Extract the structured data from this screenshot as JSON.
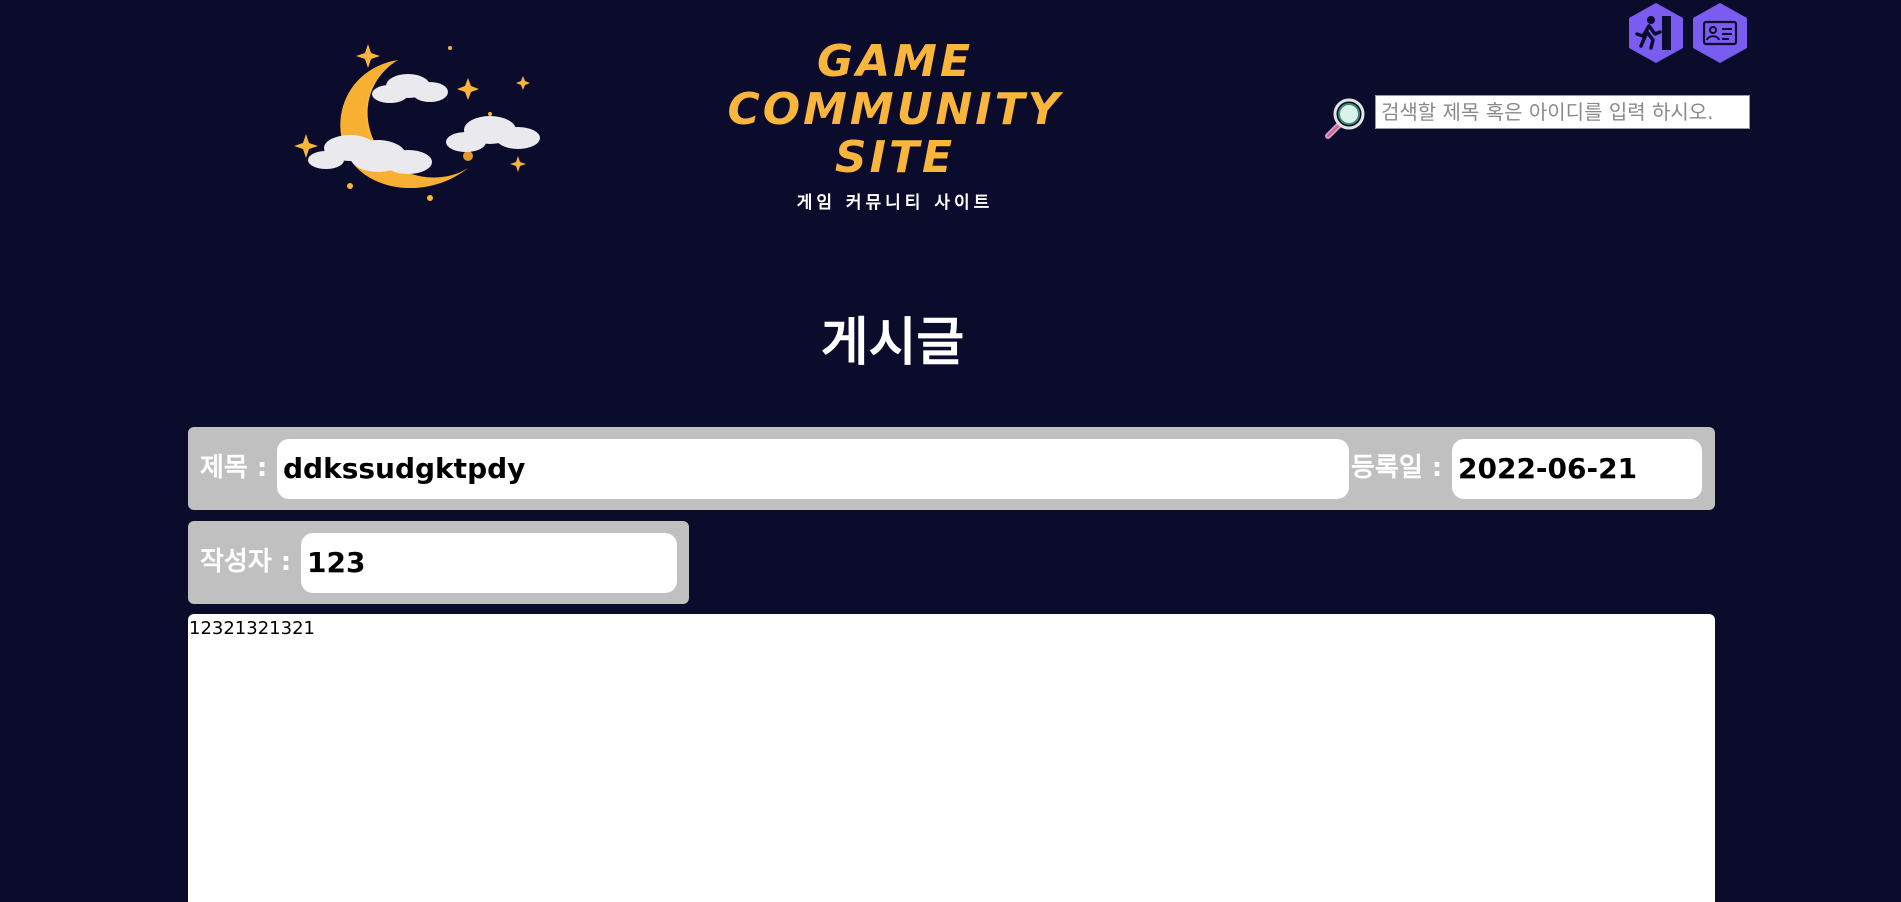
{
  "header": {
    "logo_line1": "GAME",
    "logo_line2": "COMMUNITY",
    "logo_line3": "SITE",
    "logo_subtitle": "게임 커뮤니티 사이트",
    "logout_icon": "exit-door-icon",
    "profile_icon": "id-card-icon"
  },
  "search": {
    "placeholder": "검색할 제목 혹은 아이디를 입력 하시오.",
    "icon": "magnifier-icon"
  },
  "page": {
    "title": "게시글"
  },
  "post": {
    "title_label": "제목 :",
    "title_value": "ddkssudgktpdy",
    "date_label": "등록일 :",
    "date_value": "2022-06-21",
    "author_label": "작성자 :",
    "author_value": "123",
    "content": "12321321321"
  },
  "colors": {
    "background": "#0b0c2c",
    "accent": "#7b5cf0",
    "logo": "#f9b53c",
    "field_bg": "#c0c0c0"
  }
}
